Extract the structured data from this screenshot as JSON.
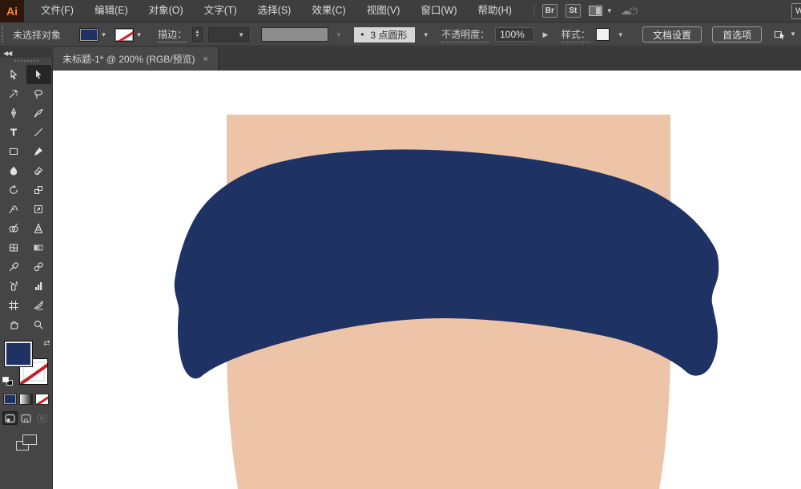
{
  "menubar": {
    "logo": "Ai",
    "items": [
      "文件(F)",
      "编辑(E)",
      "对象(O)",
      "文字(T)",
      "选择(S)",
      "效果(C)",
      "视图(V)",
      "窗口(W)",
      "帮助(H)"
    ],
    "bridge_label": "Br",
    "stock_label": "St"
  },
  "controlbar": {
    "status_label": "未选择对象",
    "stroke_label": "描边：",
    "brush_bullet": "•",
    "brush_name": "3 点圆形",
    "opacity_label": "不透明度：",
    "opacity_value": "100%",
    "style_label": "样式：",
    "document_setup_label": "文档设置",
    "preferences_label": "首选项"
  },
  "tabbar": {
    "document_title": "未标题-1* @ 200% (RGB/预览)",
    "close_glyph": "×"
  },
  "toolbar": {
    "tools": [
      {
        "name": "selection-tool",
        "active": false
      },
      {
        "name": "direct-selection-tool",
        "active": true
      },
      {
        "name": "magic-wand-tool",
        "active": false
      },
      {
        "name": "lasso-tool",
        "active": false
      },
      {
        "name": "pen-tool",
        "active": false
      },
      {
        "name": "pencil-tool",
        "active": false
      },
      {
        "name": "type-tool",
        "active": false
      },
      {
        "name": "line-segment-tool",
        "active": false
      },
      {
        "name": "rectangle-tool",
        "active": false
      },
      {
        "name": "paintbrush-tool",
        "active": false
      },
      {
        "name": "blob-brush-tool",
        "active": false
      },
      {
        "name": "eraser-tool",
        "active": false
      },
      {
        "name": "rotate-tool",
        "active": false
      },
      {
        "name": "scale-tool",
        "active": false
      },
      {
        "name": "width-tool",
        "active": false
      },
      {
        "name": "free-transform-tool",
        "active": false
      },
      {
        "name": "shape-builder-tool",
        "active": false
      },
      {
        "name": "perspective-grid-tool",
        "active": false
      },
      {
        "name": "mesh-tool",
        "active": false
      },
      {
        "name": "gradient-tool",
        "active": false
      },
      {
        "name": "eyedropper-tool",
        "active": false
      },
      {
        "name": "blend-tool",
        "active": false
      },
      {
        "name": "symbol-sprayer-tool",
        "active": false
      },
      {
        "name": "column-graph-tool",
        "active": false
      },
      {
        "name": "artboard-tool",
        "active": false
      },
      {
        "name": "slice-tool",
        "active": false
      },
      {
        "name": "hand-tool",
        "active": false
      },
      {
        "name": "zoom-tool",
        "active": false
      }
    ]
  },
  "colors": {
    "fill_navy": "#1e3263",
    "skin": "#eec4a9",
    "artboard_bg": "#ffffff",
    "stroke_none_red": "#cc2229"
  }
}
